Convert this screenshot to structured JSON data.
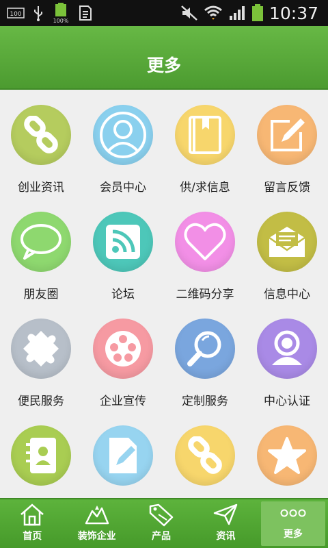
{
  "status_bar": {
    "time": "10:37",
    "battery_percent": "100%",
    "icons": [
      "screenshot-100-icon",
      "usb-icon",
      "battery-full-icon",
      "sim-icon",
      "mute-icon",
      "wifi-icon",
      "signal-icon",
      "battery-icon"
    ]
  },
  "header": {
    "title": "更多"
  },
  "grid": {
    "items": [
      {
        "label": "创业资讯",
        "icon": "link-icon",
        "color": "#b5cc5e"
      },
      {
        "label": "会员中心",
        "icon": "member-icon",
        "color": "#8ad0ee"
      },
      {
        "label": "供/求信息",
        "icon": "book-icon",
        "color": "#f7d66c"
      },
      {
        "label": "留言反馈",
        "icon": "edit-icon",
        "color": "#f7b774"
      },
      {
        "label": "朋友圈",
        "icon": "chat-icon",
        "color": "#8ed86f"
      },
      {
        "label": "论坛",
        "icon": "rss-icon",
        "color": "#4dc7b9"
      },
      {
        "label": "二维码分享",
        "icon": "heart-icon",
        "color": "#f28fe6"
      },
      {
        "label": "信息中心",
        "icon": "mail-icon",
        "color": "#c2bd45"
      },
      {
        "label": "便民服务",
        "icon": "puzzle-icon",
        "color": "#b7bfc9"
      },
      {
        "label": "企业宣传",
        "icon": "film-icon",
        "color": "#f69aa2"
      },
      {
        "label": "定制服务",
        "icon": "search-icon",
        "color": "#7aa6de"
      },
      {
        "label": "中心认证",
        "icon": "user-icon",
        "color": "#a98ae6"
      },
      {
        "label": "",
        "icon": "contacts-icon",
        "color": "#a9cd52"
      },
      {
        "label": "",
        "icon": "document-icon",
        "color": "#97d4f0"
      },
      {
        "label": "",
        "icon": "link-icon",
        "color": "#f7d66c"
      },
      {
        "label": "",
        "icon": "star-icon",
        "color": "#f7b774"
      }
    ]
  },
  "tabbar": {
    "tabs": [
      {
        "label": "首页",
        "icon": "home-icon",
        "active": false
      },
      {
        "label": "装饰企业",
        "icon": "company-icon",
        "active": false
      },
      {
        "label": "产品",
        "icon": "sale-tag-icon",
        "active": false
      },
      {
        "label": "资讯",
        "icon": "paper-plane-icon",
        "active": false
      },
      {
        "label": "更多",
        "icon": "more-dots-icon",
        "active": true
      }
    ]
  }
}
